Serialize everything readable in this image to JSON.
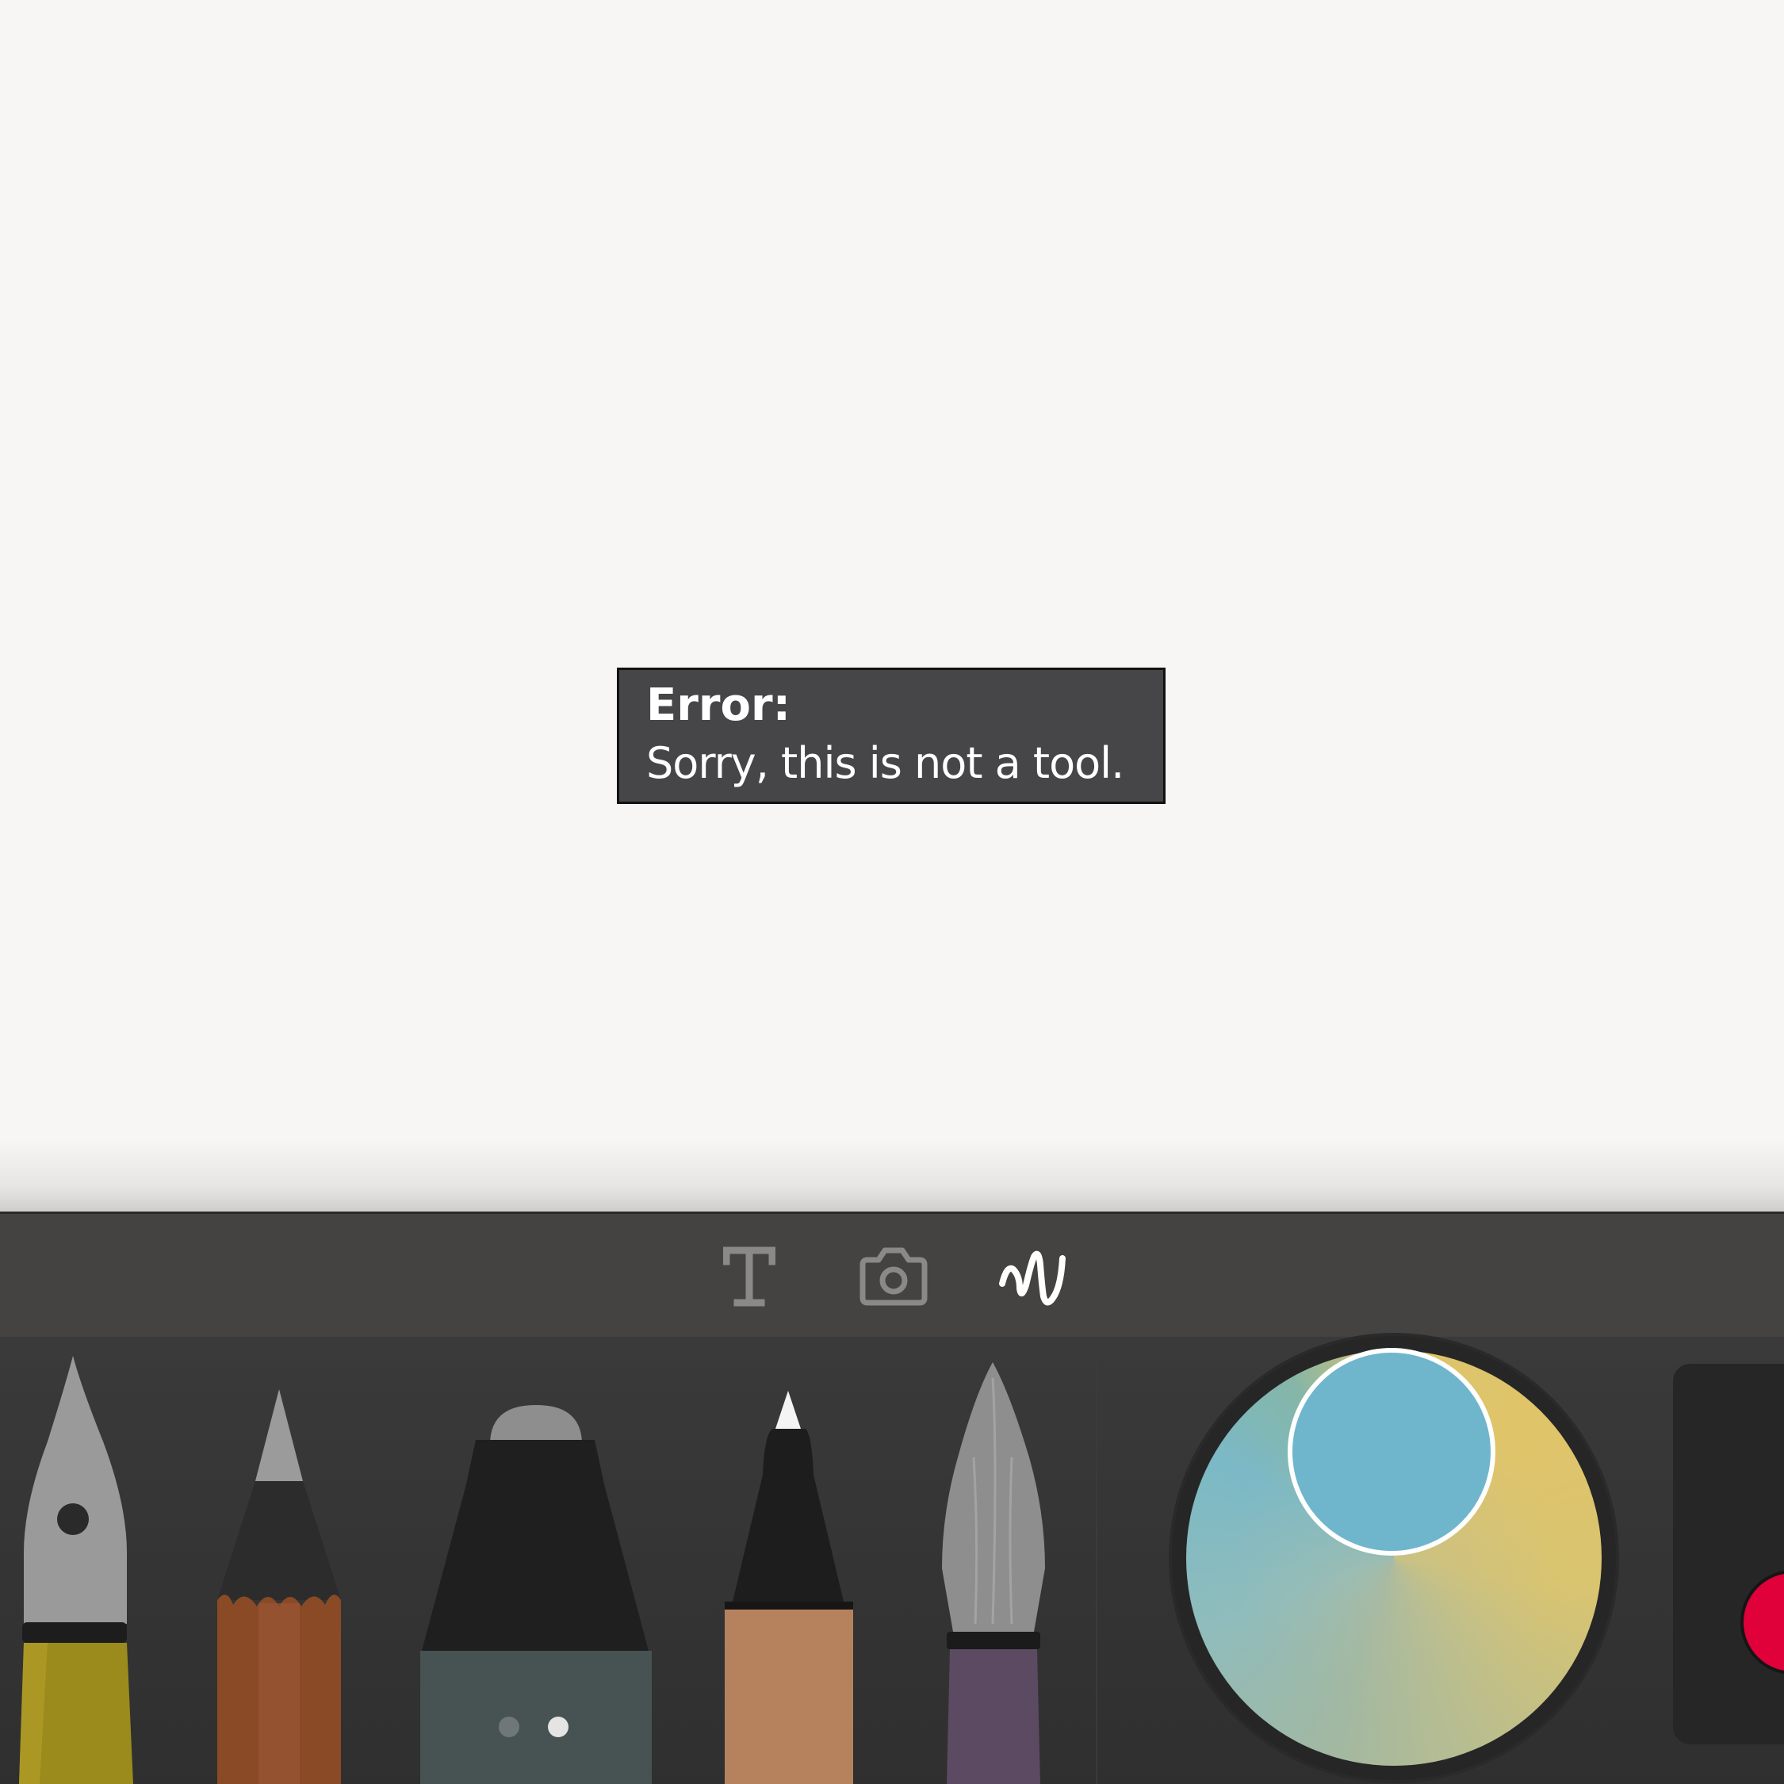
{
  "error": {
    "title": "Error:",
    "message": "Sorry, this is not a tool."
  },
  "toolbar": {
    "modes": [
      {
        "name": "text",
        "icon": "text-icon",
        "selected": false
      },
      {
        "name": "camera",
        "icon": "camera-icon",
        "selected": false
      },
      {
        "name": "draw",
        "icon": "scribble-icon",
        "selected": true
      }
    ],
    "tools": [
      {
        "name": "fountain-pen",
        "color": "#9b8a1c"
      },
      {
        "name": "pencil",
        "color": "#8a4a25"
      },
      {
        "name": "marker",
        "color": "#475252"
      },
      {
        "name": "fineliner",
        "color": "#b6825e"
      },
      {
        "name": "brush",
        "color": "#5c4a63"
      }
    ]
  },
  "colors": {
    "selected": "#6fb6cc",
    "swatch_side": "#e0003a",
    "canvas_bg": "#f7f6f4",
    "toolbar_bg": "#444342"
  }
}
